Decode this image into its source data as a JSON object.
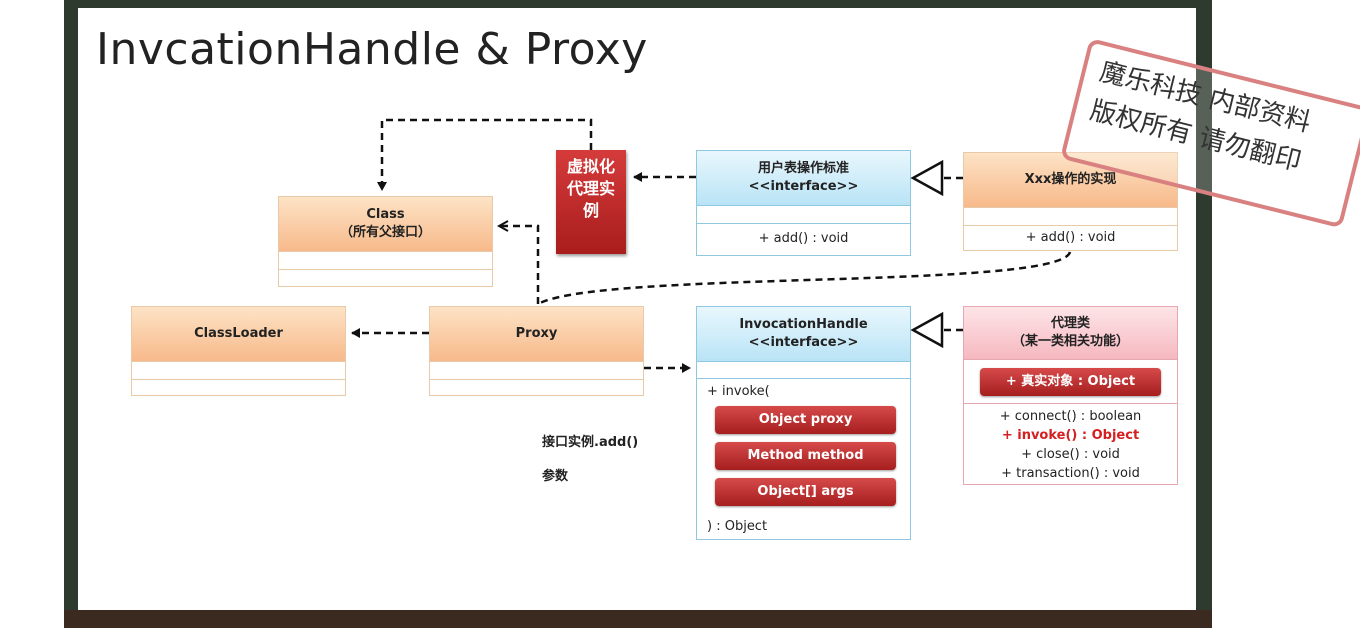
{
  "title": "InvcationHandle & Proxy",
  "virtual_instance_label": "虚拟化代理实例",
  "class_box": {
    "name": "Class",
    "subtitle": "（所有父接口）"
  },
  "classloader_box": {
    "name": "ClassLoader"
  },
  "proxy_box": {
    "name": "Proxy"
  },
  "user_interface_box": {
    "name": "用户表操作标准",
    "stereotype": "<<interface>>",
    "method": "+ add() : void"
  },
  "impl_box": {
    "name": "Xxx操作的实现",
    "method": "+ add() : void"
  },
  "invocation_box": {
    "name": "InvocationHandle",
    "stereotype": "<<interface>>",
    "method_open": "+ invoke(",
    "params": [
      "Object proxy",
      "Method method",
      "Object[] args"
    ],
    "method_close": ") : Object"
  },
  "proxy_class_box": {
    "name": "代理类",
    "subtitle": "（某一类相关功能）",
    "field": "+ 真实对象 : Object",
    "methods": [
      "+ connect() : boolean",
      "+ invoke() : Object",
      "+ close() : void",
      "+ transaction() : void"
    ]
  },
  "notes": {
    "call": "接口实例.add()",
    "params": "参数"
  },
  "stamp": {
    "line1": "魔乐科技 内部资料",
    "line2": "版权所有 请勿翻印"
  },
  "colors": {
    "red": "#b82323",
    "invoke_highlight": "#d42020",
    "arrow": "#111111"
  }
}
